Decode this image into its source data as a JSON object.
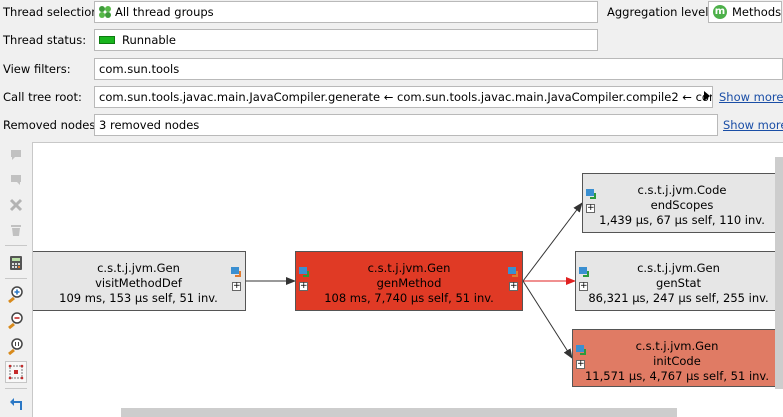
{
  "filters": {
    "thread_selection": {
      "label": "Thread selection:",
      "value": "All thread groups",
      "icon": "thread-groups-icon"
    },
    "aggregation": {
      "label": "Aggregation level:",
      "value": "Methods",
      "icon_letter": "m"
    },
    "thread_status": {
      "label": "Thread status:",
      "value": "Runnable",
      "color": "#19b51e"
    },
    "view_filters": {
      "label": "View filters:",
      "value": "com.sun.tools"
    },
    "call_tree_root": {
      "label": "Call tree root:",
      "value": "com.sun.tools.javac.main.JavaCompiler.generate ← com.sun.tools.javac.main.JavaCompiler.compile2 ← com.sun.tools.",
      "link": "Show more"
    },
    "removed_nodes": {
      "label": "Removed nodes:",
      "value": "3 removed nodes",
      "link": "Show more"
    }
  },
  "toolbar": [
    {
      "name": "navigate-back-icon",
      "enabled": false
    },
    {
      "name": "navigate-forward-icon",
      "enabled": false
    },
    {
      "name": "remove-node-icon",
      "enabled": false
    },
    {
      "name": "delete-icon",
      "enabled": false
    },
    {
      "name": "calculator-icon",
      "enabled": true
    },
    {
      "name": "zoom-in-icon",
      "enabled": true
    },
    {
      "name": "zoom-out-icon",
      "enabled": true
    },
    {
      "name": "zoom-100-icon",
      "enabled": true
    },
    {
      "name": "fit-to-window-icon",
      "enabled": true
    },
    {
      "name": "undo-icon",
      "enabled": true
    }
  ],
  "graph": {
    "nodes": [
      {
        "id": "visitMethodDef",
        "class": "c.s.t.j.jvm.Gen",
        "method": "visitMethodDef",
        "stats": "109 ms, 153 µs self, 51 inv.",
        "color": "#e6e6e6"
      },
      {
        "id": "genMethod",
        "class": "c.s.t.j.jvm.Gen",
        "method": "genMethod",
        "stats": "108 ms, 7,740 µs self, 51 inv.",
        "color": "#e03a25"
      },
      {
        "id": "endScopes",
        "class": "c.s.t.j.jvm.Code",
        "method": "endScopes",
        "stats": "1,439 µs, 67 µs self, 110 inv.",
        "color": "#e6e6e6"
      },
      {
        "id": "genStat",
        "class": "c.s.t.j.jvm.Gen",
        "method": "genStat",
        "stats": "86,321 µs, 247 µs self, 255 inv.",
        "color": "#e6e6e6"
      },
      {
        "id": "initCode",
        "class": "c.s.t.j.jvm.Gen",
        "method": "initCode",
        "stats": "11,571 µs, 4,767 µs self, 51 inv.",
        "color": "#e07b64"
      }
    ],
    "edges": [
      {
        "from": "visitMethodDef",
        "to": "genMethod",
        "color": "#333333"
      },
      {
        "from": "genMethod",
        "to": "endScopes",
        "color": "#333333"
      },
      {
        "from": "genMethod",
        "to": "genStat",
        "color": "#e02020"
      },
      {
        "from": "genMethod",
        "to": "initCode",
        "color": "#333333"
      }
    ]
  }
}
